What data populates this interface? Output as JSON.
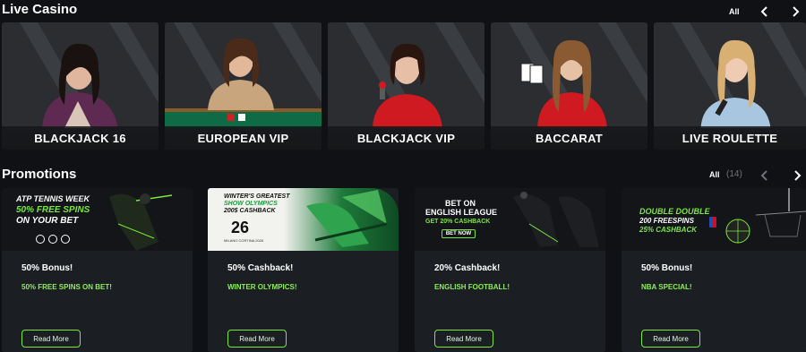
{
  "live_casino": {
    "title": "Live Casino",
    "all_label": "All",
    "cards": [
      {
        "label": "BLACKJACK 16"
      },
      {
        "label": "EUROPEAN VIP"
      },
      {
        "label": "BLACKJACK VIP"
      },
      {
        "label": "BACCARAT"
      },
      {
        "label": "LIVE ROULETTE"
      }
    ]
  },
  "promotions": {
    "title": "Promotions",
    "all_label": "All",
    "count": "(14)",
    "cards": [
      {
        "banner_lines": [
          "ATP TENNIS WEEK",
          "50% FREE SPINS",
          "ON YOUR BET"
        ],
        "title": "50% Bonus!",
        "subtitle": "50% FREE SPINS ON BET!",
        "button": "Read More"
      },
      {
        "banner_lines": [
          "WINTER'S GREATEST",
          "SHOW OLYMPICS",
          "200$ CASHBACK"
        ],
        "banner_badge": "MILANO CORTINA 2026",
        "title": "50% Cashback!",
        "subtitle": "WINTER OLYMPICS!",
        "button": "Read More"
      },
      {
        "banner_lines": [
          "BET ON",
          "ENGLISH LEAGUE",
          "GET 20% CASHBACK"
        ],
        "banner_button": "BET NOW",
        "title": "20% Cashback!",
        "subtitle": "ENGLISH FOOTBALL!",
        "button": "Read More"
      },
      {
        "banner_lines": [
          "DOUBLE DOUBLE",
          "200 FREESPINS",
          "25% CASHBACK"
        ],
        "title": "50% Bonus!",
        "subtitle": "NBA SPECIAL!",
        "button": "Read More"
      }
    ]
  },
  "colors": {
    "accent_green": "#79e83a",
    "background": "#0f1114",
    "card": "#1b1e23"
  }
}
